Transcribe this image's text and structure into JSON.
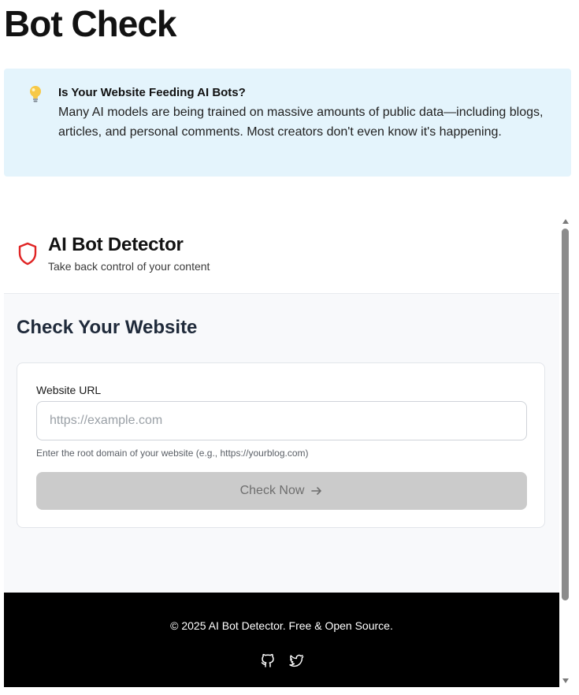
{
  "page": {
    "title": "Bot Check"
  },
  "callout": {
    "icon": "lightbulb-icon",
    "heading": "Is Your Website Feeding AI Bots?",
    "body": "Many AI models are being trained on massive amounts of public data—including blogs, articles, and personal comments. Most creators don't even know it's happening.",
    "background": "#e4f4fc"
  },
  "app": {
    "icon": "shield-icon",
    "title": "AI Bot Detector",
    "subtitle": "Take back control of your content",
    "accent": "#e02424"
  },
  "check": {
    "section_title": "Check Your Website",
    "url_label": "Website URL",
    "url_value": "",
    "url_placeholder": "https://example.com",
    "url_hint": "Enter the root domain of your website (e.g., https://yourblog.com)",
    "button_label": "Check Now",
    "button_icon": "arrow-right-icon",
    "button_state": "disabled"
  },
  "footer": {
    "text": "© 2025 AI Bot Detector. Free & Open Source.",
    "icons": [
      "github-icon",
      "twitter-icon"
    ]
  }
}
